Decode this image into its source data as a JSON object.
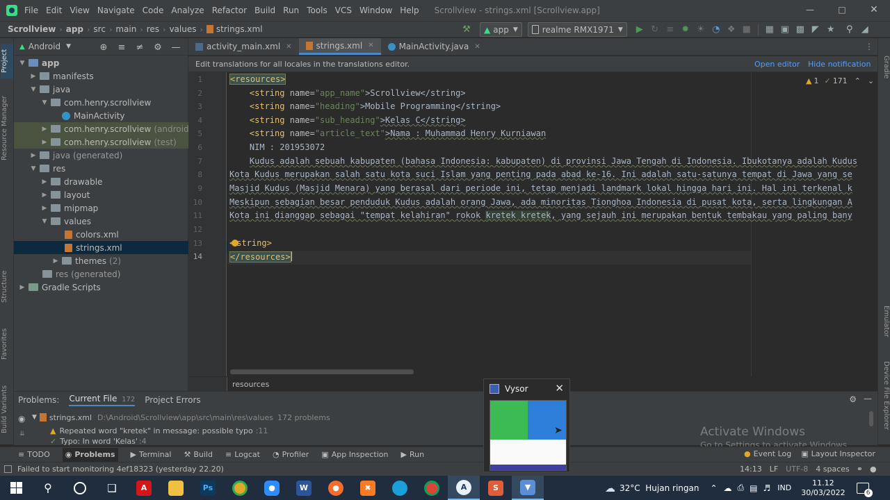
{
  "menubar": {
    "items": [
      "File",
      "Edit",
      "View",
      "Navigate",
      "Code",
      "Analyze",
      "Refactor",
      "Build",
      "Run",
      "Tools",
      "VCS",
      "Window",
      "Help"
    ],
    "window_title": "Scrollview - strings.xml [Scrollview.app]"
  },
  "navbar": {
    "crumbs": [
      "Scrollview",
      "app",
      "src",
      "main",
      "res",
      "values",
      "strings.xml"
    ],
    "run_config": "app",
    "device": "realme RMX1971"
  },
  "left_strip": {
    "tabs": [
      "Project",
      "Resource Manager",
      "Structure",
      "Favorites",
      "Build Variants"
    ]
  },
  "right_strip": {
    "tabs": [
      "Gradle",
      "Emulator",
      "Device File Explorer"
    ]
  },
  "project_panel": {
    "view_label": "Android",
    "tree": [
      {
        "label": "app",
        "note": ""
      },
      {
        "label": "manifests",
        "note": ""
      },
      {
        "label": "java",
        "note": ""
      },
      {
        "label": "com.henry.scrollview",
        "note": ""
      },
      {
        "label": "MainActivity",
        "note": ""
      },
      {
        "label": "com.henry.scrollview",
        "note": "(androidTest)"
      },
      {
        "label": "com.henry.scrollview",
        "note": "(test)"
      },
      {
        "label": "java (generated)",
        "note": ""
      },
      {
        "label": "res",
        "note": ""
      },
      {
        "label": "drawable",
        "note": ""
      },
      {
        "label": "layout",
        "note": ""
      },
      {
        "label": "mipmap",
        "note": ""
      },
      {
        "label": "values",
        "note": ""
      },
      {
        "label": "colors.xml",
        "note": ""
      },
      {
        "label": "strings.xml",
        "note": ""
      },
      {
        "label": "themes",
        "note": "(2)"
      },
      {
        "label": "res (generated)",
        "note": ""
      },
      {
        "label": "Gradle Scripts",
        "note": ""
      }
    ]
  },
  "editor_tabs": [
    "activity_main.xml",
    "strings.xml",
    "MainActivity.java"
  ],
  "notification": {
    "text": "Edit translations for all locales in the translations editor.",
    "open_editor": "Open editor",
    "hide": "Hide notification"
  },
  "inspections": {
    "warnings": "1",
    "typos": "171"
  },
  "code": {
    "line_numbers": [
      "1",
      "2",
      "3",
      "4",
      "5",
      "6",
      "7",
      "8",
      "9",
      "10",
      "11",
      "12",
      "13",
      "14"
    ],
    "l1_tag": "<resources>",
    "l2_open": "<string ",
    "l2_attr": "name=",
    "l2_val": "\"app_name\"",
    "l2_text": ">Scrollview</string>",
    "l3_open": "<string ",
    "l3_attr": "name=",
    "l3_val": "\"heading\"",
    "l3_text": ">Mobile Programming</string>",
    "l4_open": "<string ",
    "l4_attr": "name=",
    "l4_val": "\"sub_heading\"",
    "l4_text": ">Kelas C</string>",
    "l5_open": "<string ",
    "l5_attr": "name=",
    "l5_val": "\"article_text\"",
    "l5_text": ">Nama : Muhammad Henry Kurniawan",
    "l6": "NIM : 201953072",
    "l7": "Kudus adalah sebuah kabupaten (bahasa Indonesia: kabupaten) di provinsi Jawa Tengah di Indonesia. Ibukotanya adalah Kudus",
    "l8": "Kota Kudus merupakan salah satu kota suci Islam yang penting pada abad ke-16. Ini adalah satu-satunya tempat di Jawa yang se",
    "l9": "Masjid Kudus (Masjid Menara) yang berasal dari periode ini, tetap menjadi landmark lokal hingga hari ini. Hal ini terkenal k",
    "l10": "Meskipun sebagian besar penduduk Kudus adalah orang Jawa, ada minoritas Tionghoa Indonesia di pusat kota, serta lingkungan A",
    "l11a": "Kota ini dianggap sebagai \"tempat kelahiran\" rokok ",
    "l11b": "kretek kretek",
    "l11c": ", yang sejauh ini merupakan bentuk tembakau yang paling bany",
    "l13a": "<",
    "l13b": "string>",
    "l14": "</resources>"
  },
  "editor_breadcrumb": "resources",
  "problems": {
    "label": "Problems:",
    "tabs": [
      {
        "label": "Current File",
        "count": "172"
      },
      {
        "label": "Project Errors",
        "count": ""
      }
    ],
    "file": "strings.xml",
    "path": "D:\\Android\\Scrollview\\app\\src\\main\\res\\values",
    "count_text": "172 problems",
    "item1": "Repeated word \"kretek\" in message: possible typo",
    "item1_line": ":11",
    "item2": "Typo: In word 'Kelas'",
    "item2_line": ":4"
  },
  "bottom_tabs": [
    "TODO",
    "Problems",
    "Terminal",
    "Build",
    "Logcat",
    "Profiler",
    "App Inspection",
    "Run"
  ],
  "bottom_right_tabs": [
    "Event Log",
    "Layout Inspector"
  ],
  "status": {
    "message": "Failed to start monitoring 4ef18323 (yesterday 22.20)",
    "position": "14:13",
    "line_sep": "LF",
    "encoding": "UTF-8",
    "indent": "4 spaces"
  },
  "watermark": {
    "title": "Activate Windows",
    "subtitle": "Go to Settings to activate Windows."
  },
  "vysor": {
    "title": "Vysor"
  },
  "taskbar": {
    "weather": "32°C  Hujan ringan",
    "lang": "IND",
    "time": "11.12",
    "date": "30/03/2022",
    "notif_count": "6"
  },
  "colors": {
    "accent": "#4a88c7",
    "selection": "#0d293e",
    "tag": "#e8bf6a",
    "string": "#6a8759"
  }
}
